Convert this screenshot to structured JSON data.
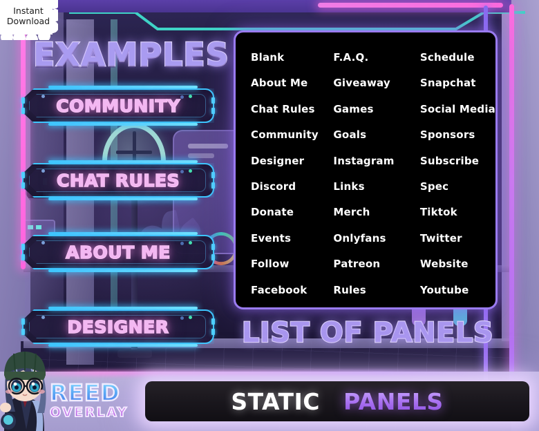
{
  "badge": {
    "text": "Instant\nDownload"
  },
  "headings": {
    "examples": "EXAMPLES",
    "list_of_panels": "LIST OF PANELS"
  },
  "example_buttons": [
    {
      "label": "COMMUNITY"
    },
    {
      "label": "CHAT RULES"
    },
    {
      "label": "ABOUT ME"
    },
    {
      "label": "DESIGNER"
    }
  ],
  "panel_list": {
    "columns": [
      [
        "Blank",
        "About Me",
        "Chat Rules",
        "Community",
        "Designer",
        "Discord",
        "Donate",
        "Events",
        "Follow",
        "Facebook"
      ],
      [
        "F.A.Q.",
        "Giveaway",
        "Games",
        "Goals",
        "Instagram",
        "Links",
        "Merch",
        "Onlyfans",
        "Patreon",
        "Rules"
      ],
      [
        "Schedule",
        "Snapchat",
        "Social Media",
        "Sponsors",
        "Subscribe",
        "Spec",
        "Tiktok",
        "Twitter",
        "Website",
        "Youtube"
      ]
    ]
  },
  "bottom_bar": {
    "word_static": "STATIC",
    "word_panels": "PANELS"
  },
  "logo": {
    "line1": "REED",
    "line2": "OVERLAY"
  },
  "colors": {
    "neon_cyan": "#3ec6ff",
    "neon_pink": "#ff6bdd",
    "neon_purple": "#9a7bf0",
    "button_text": "#f2b8f2",
    "title_purple": "#a996ef",
    "list_text": "#ffffff",
    "list_bg": "#000000"
  }
}
